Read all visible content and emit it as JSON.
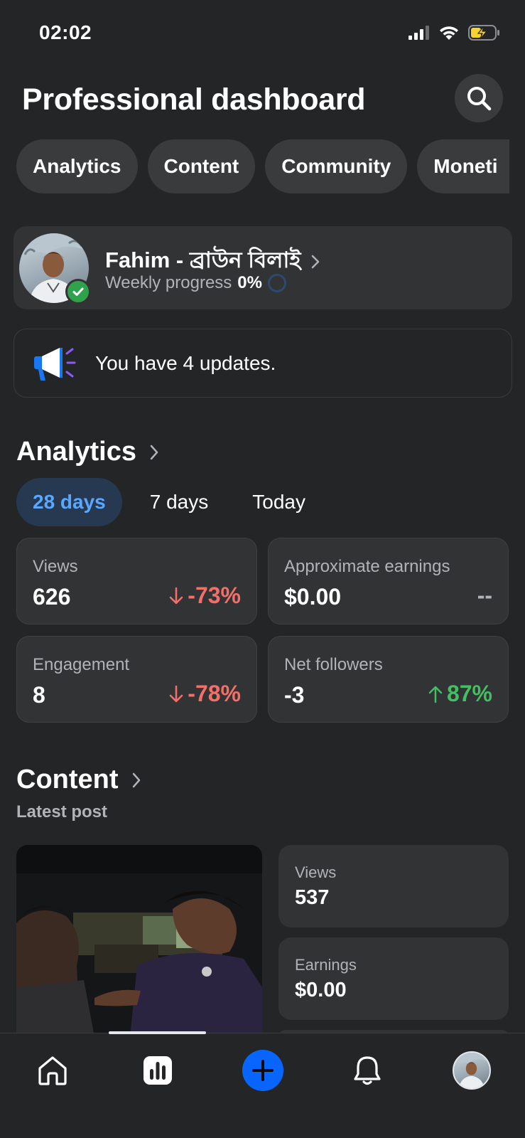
{
  "status_bar": {
    "time": "02:02"
  },
  "header": {
    "title": "Professional dashboard"
  },
  "chips": [
    "Analytics",
    "Content",
    "Community",
    "Moneti"
  ],
  "profile": {
    "name": "Fahim  - ব্রাউন বিলাই",
    "progress_label": "Weekly progress",
    "progress_value": "0%",
    "weekly_progress_fraction": 0
  },
  "updates": {
    "text": "You have 4 updates."
  },
  "analytics": {
    "title": "Analytics",
    "tabs": [
      "28 days",
      "7 days",
      "Today"
    ],
    "active_tab": "28 days",
    "cards": [
      {
        "label": "Views",
        "value": "626",
        "change": "-73%",
        "direction": "down"
      },
      {
        "label": "Approximate earnings",
        "value": "$0.00",
        "change": "--",
        "direction": "none"
      },
      {
        "label": "Engagement",
        "value": "8",
        "change": "-78%",
        "direction": "down"
      },
      {
        "label": "Net followers",
        "value": "-3",
        "change": "87%",
        "direction": "up"
      }
    ]
  },
  "content": {
    "title": "Content",
    "subtitle": "Latest post",
    "stats": [
      {
        "label": "Views",
        "value": "537"
      },
      {
        "label": "Earnings",
        "value": "$0.00"
      }
    ]
  },
  "bottom_nav": {
    "items": [
      "home-icon",
      "dashboard-icon",
      "create-icon",
      "bell-icon",
      "profile-avatar"
    ],
    "active": "dashboard-icon"
  },
  "colors": {
    "background": "#242526",
    "card": "#323334",
    "accent_blue": "#0866ff",
    "negative": "#f3706a",
    "positive": "#45bd62"
  }
}
